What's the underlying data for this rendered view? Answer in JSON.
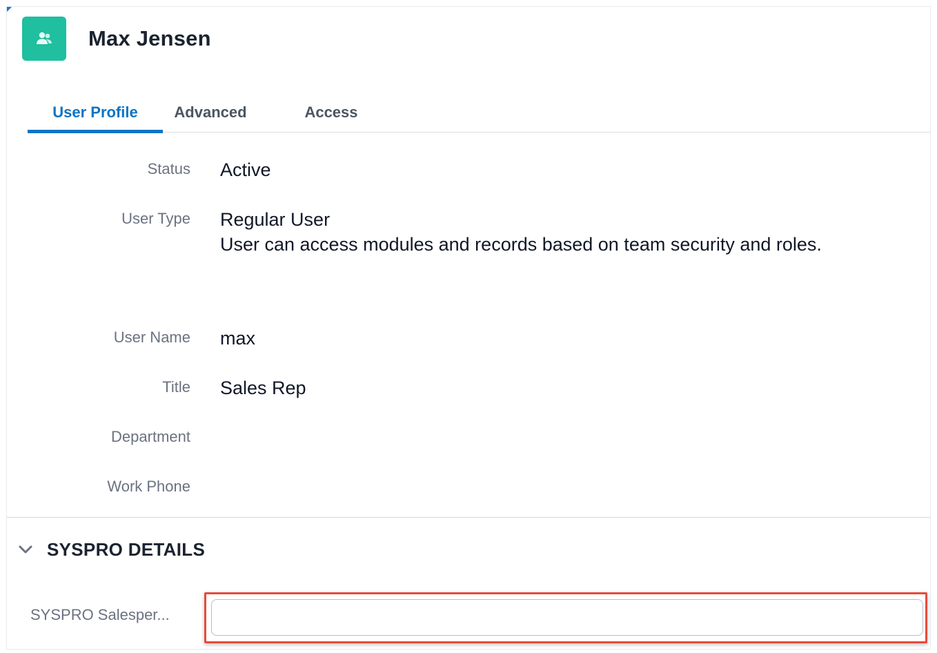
{
  "record": {
    "title": "Max Jensen",
    "icon": "users-icon",
    "avatar_color": "#1fbf9f"
  },
  "tabs": [
    {
      "label": "User Profile",
      "active": true
    },
    {
      "label": "Advanced",
      "active": false
    },
    {
      "label": "Access",
      "active": false
    }
  ],
  "fields": {
    "status": {
      "label": "Status",
      "value": "Active"
    },
    "user_type": {
      "label": "User Type",
      "value": "Regular User",
      "description": "User can access modules and records based on team security and roles."
    },
    "user_name": {
      "label": "User Name",
      "value": "max"
    },
    "title": {
      "label": "Title",
      "value": "Sales Rep"
    },
    "department": {
      "label": "Department",
      "value": ""
    },
    "work_phone": {
      "label": "Work Phone",
      "value": ""
    }
  },
  "section": {
    "title": "SYSPRO DETAILS",
    "icon": "chevron-down-icon",
    "fields": {
      "salesperson": {
        "label": "SYSPRO Salesper...",
        "value": "",
        "placeholder": ""
      }
    }
  },
  "colors": {
    "accent": "#0b74c4",
    "highlight": "#e84b3a"
  }
}
